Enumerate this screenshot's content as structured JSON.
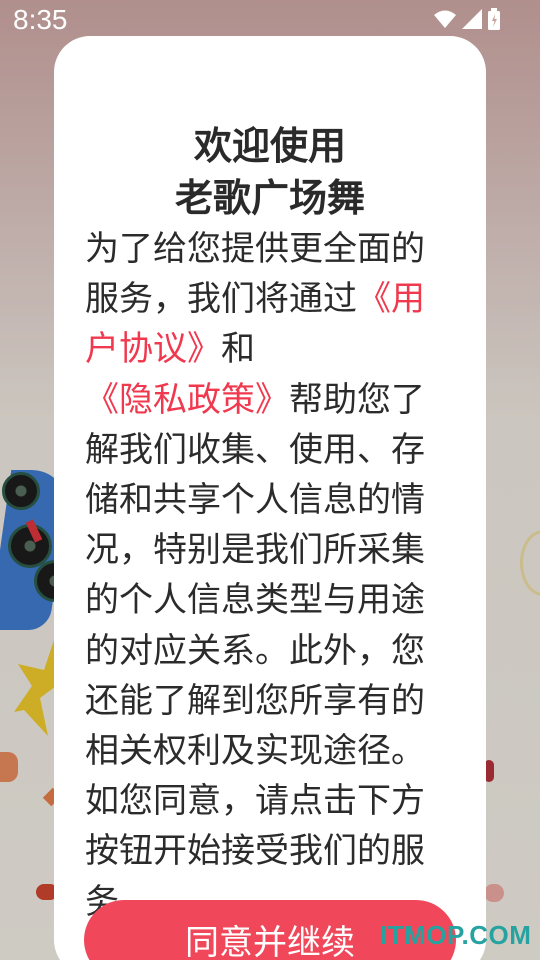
{
  "status_bar": {
    "time": "8:35",
    "icons": [
      "wifi-icon",
      "signal-icon",
      "battery-icon"
    ]
  },
  "dialog": {
    "title_line1": "欢迎使用",
    "title_line2": "老歌广场舞",
    "body": {
      "part1": "为了给您提供更全面的服务，我们将通过",
      "link_user_agreement": "《用户协议》",
      "part2": "和",
      "link_privacy_policy": "《隐私政策》",
      "part3": "帮助您了解我们收集、使用、存储和共享个人信息的情况，特别是我们所采集的个人信息类型与用途的对应关系。此外，您还能了解到您所享有的相关权利及实现途径。如您同意，请点击下方按钮开始接受我们的服务。"
    },
    "agree_button_label": "同意并继续"
  },
  "watermark": "ITMOP.COM",
  "colors": {
    "accent": "#f0485a",
    "link": "#f0394e",
    "watermark": "#26a3a0"
  }
}
